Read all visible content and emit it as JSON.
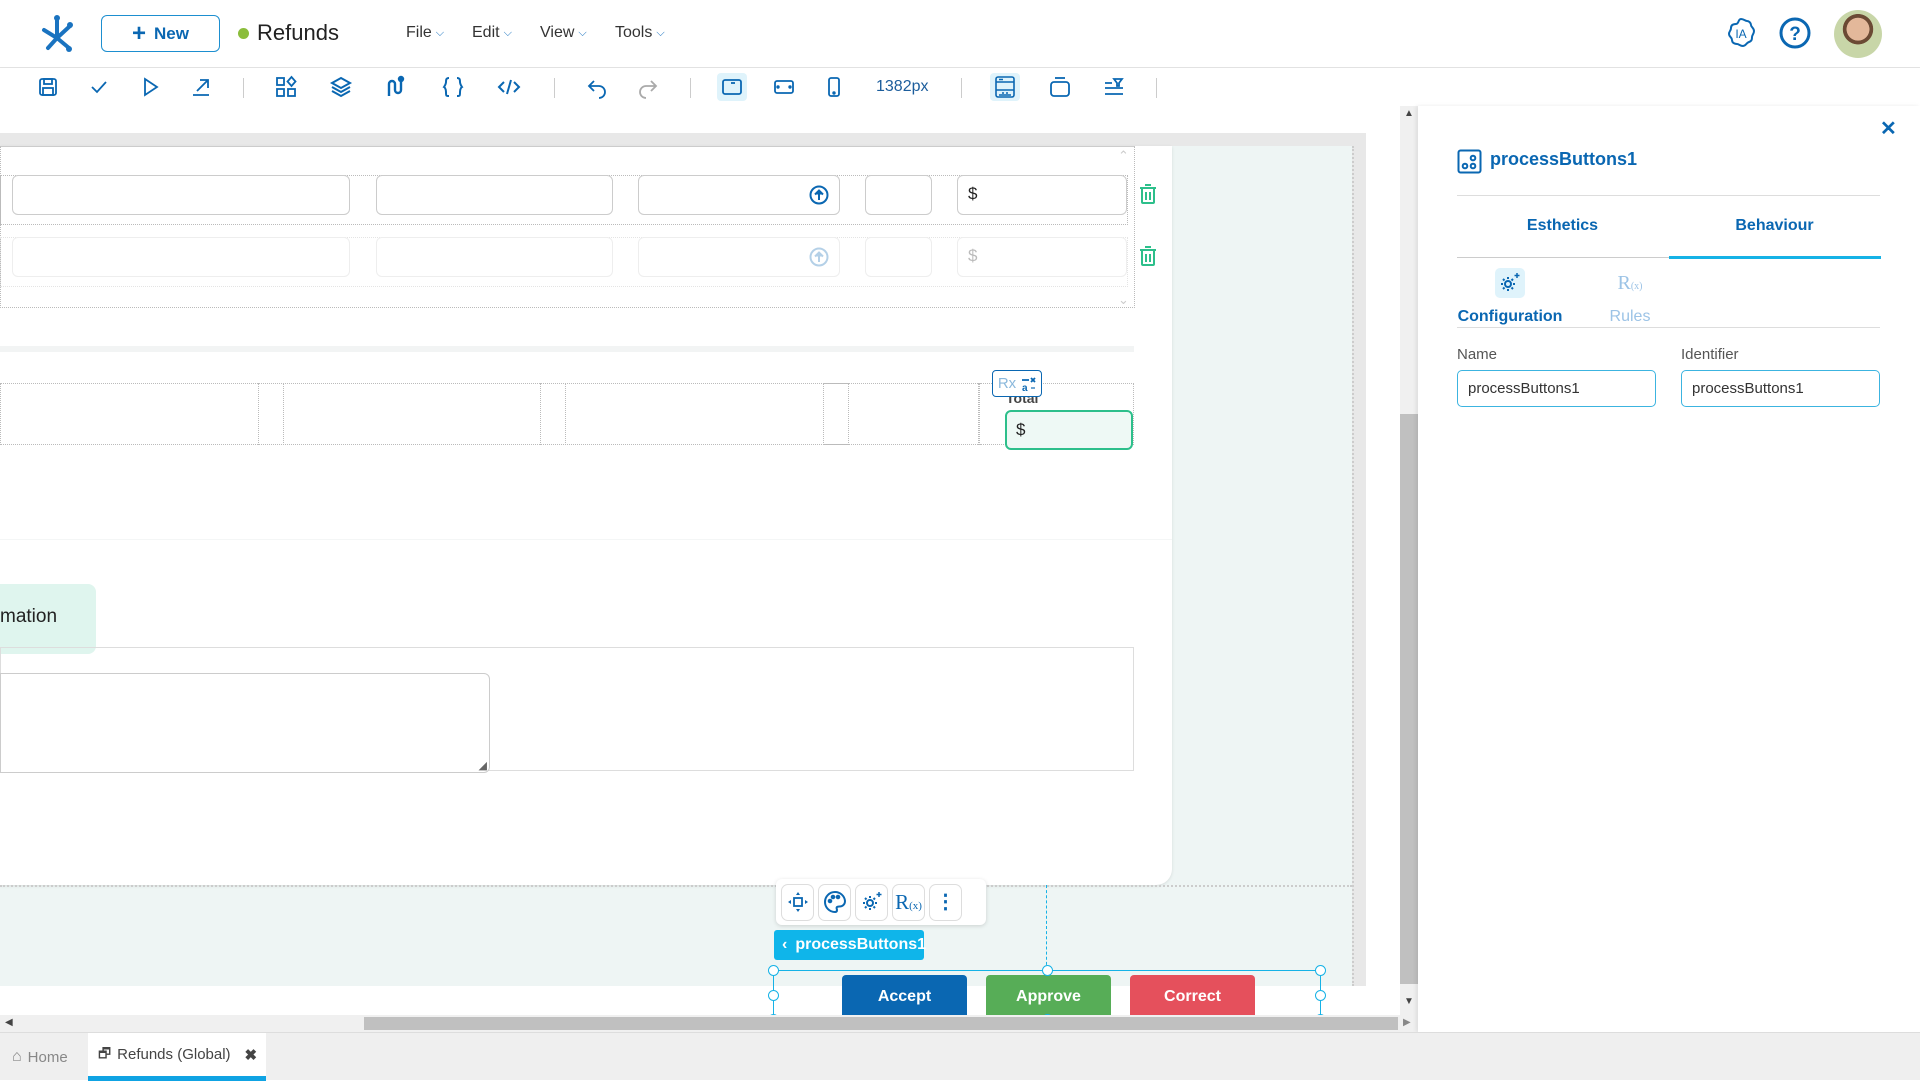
{
  "header": {
    "new_label": "New",
    "app_title": "Refunds",
    "status_color": "#8bbd3c",
    "menus": [
      {
        "label": "File"
      },
      {
        "label": "Edit"
      },
      {
        "label": "View"
      },
      {
        "label": "Tools"
      }
    ],
    "ia_label": "IA"
  },
  "toolbar": {
    "width_label": "1382px",
    "icons": [
      "save-icon",
      "check-icon",
      "play-icon",
      "export-icon",
      "components-icon",
      "layers-icon",
      "flow-icon",
      "braces-icon",
      "code-icon",
      "undo-icon",
      "redo-icon",
      "desktop-icon",
      "tablet-icon",
      "mobile-icon",
      "page-layout-icon",
      "window-icon",
      "filter-bar-icon"
    ]
  },
  "canvas": {
    "dollar_symbol": "$",
    "total_label": "Total",
    "section_label_partial": "mation",
    "rx_badge": "Rx",
    "selected_component": "processButtons1",
    "buttons": [
      {
        "label": "Accept",
        "color": "#0a67b2"
      },
      {
        "label": "Approve",
        "color": "#57ad57"
      },
      {
        "label": "Correct",
        "color": "#e5505c"
      }
    ],
    "rules_glyph": "R(x)"
  },
  "panel": {
    "title": "processButtons1",
    "tabs": [
      {
        "label": "Esthetics",
        "active": false
      },
      {
        "label": "Behaviour",
        "active": true
      }
    ],
    "subtabs": [
      {
        "label": "Configuration",
        "active": true
      },
      {
        "label": "Rules",
        "active": false
      }
    ],
    "rules_glyph": "R(x)",
    "fields": {
      "name_label": "Name",
      "name_value": "processButtons1",
      "identifier_label": "Identifier",
      "identifier_value": "processButtons1"
    }
  },
  "bottom_tabs": [
    {
      "label": "Home",
      "active": false
    },
    {
      "label": "Refunds (Global)",
      "active": true
    }
  ],
  "colors": {
    "primary": "#0a67b2",
    "accent": "#16b2e6",
    "success": "#2dbf8b"
  }
}
